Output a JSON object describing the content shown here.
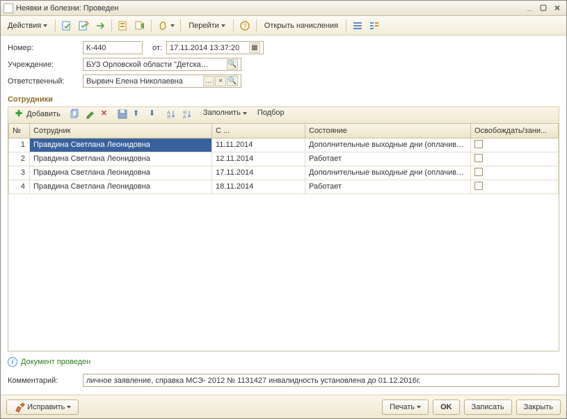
{
  "window": {
    "title": "Неявки и болезни: Проведен"
  },
  "toolbar": {
    "actions_label": "Действия",
    "goto_label": "Перейти",
    "open_calc_label": "Открыть начисления"
  },
  "form": {
    "number_lbl": "Номер:",
    "number_val": "К-440",
    "date_lbl": "от:",
    "date_val": "17.11.2014 13:37:20",
    "org_lbl": "Учреждение:",
    "org_val": "БУЗ Орловской области \"Детская г ...",
    "resp_lbl": "Ответственный:",
    "resp_val": "Вырвич Елена Николаевна"
  },
  "section": {
    "title": "Сотрудники"
  },
  "subtoolbar": {
    "add_label": "Добавить",
    "fill_label": "Заполнить",
    "pick_label": "Подбор"
  },
  "grid": {
    "headers": {
      "num": "№",
      "employee": "Сотрудник",
      "from": "С ...",
      "state": "Состояние",
      "free": "Освобождать/зани..."
    },
    "rows": [
      {
        "n": "1",
        "emp": "Правдина Светлана Леонидовна",
        "from": "11.11.2014",
        "state": "Дополнительные выходные дни (оплачивае...",
        "chk": false
      },
      {
        "n": "2",
        "emp": "Правдина Светлана Леонидовна",
        "from": "12.11.2014",
        "state": "Работает",
        "chk": false
      },
      {
        "n": "3",
        "emp": "Правдина Светлана Леонидовна",
        "from": "17.11.2014",
        "state": "Дополнительные выходные дни (оплачивае...",
        "chk": false
      },
      {
        "n": "4",
        "emp": "Правдина Светлана Леонидовна",
        "from": "18.11.2014",
        "state": "Работает",
        "chk": false
      }
    ]
  },
  "status": {
    "text": "Документ проведен"
  },
  "comment": {
    "lbl": "Комментарий:",
    "val": "личное заявление, справка МСЭ- 2012 № 1131427  инвалидность установлена до 01.12.2016г."
  },
  "footer": {
    "fix_label": "Исправить",
    "print_label": "Печать",
    "ok_label": "OK",
    "save_label": "Записать",
    "close_label": "Закрыть"
  }
}
